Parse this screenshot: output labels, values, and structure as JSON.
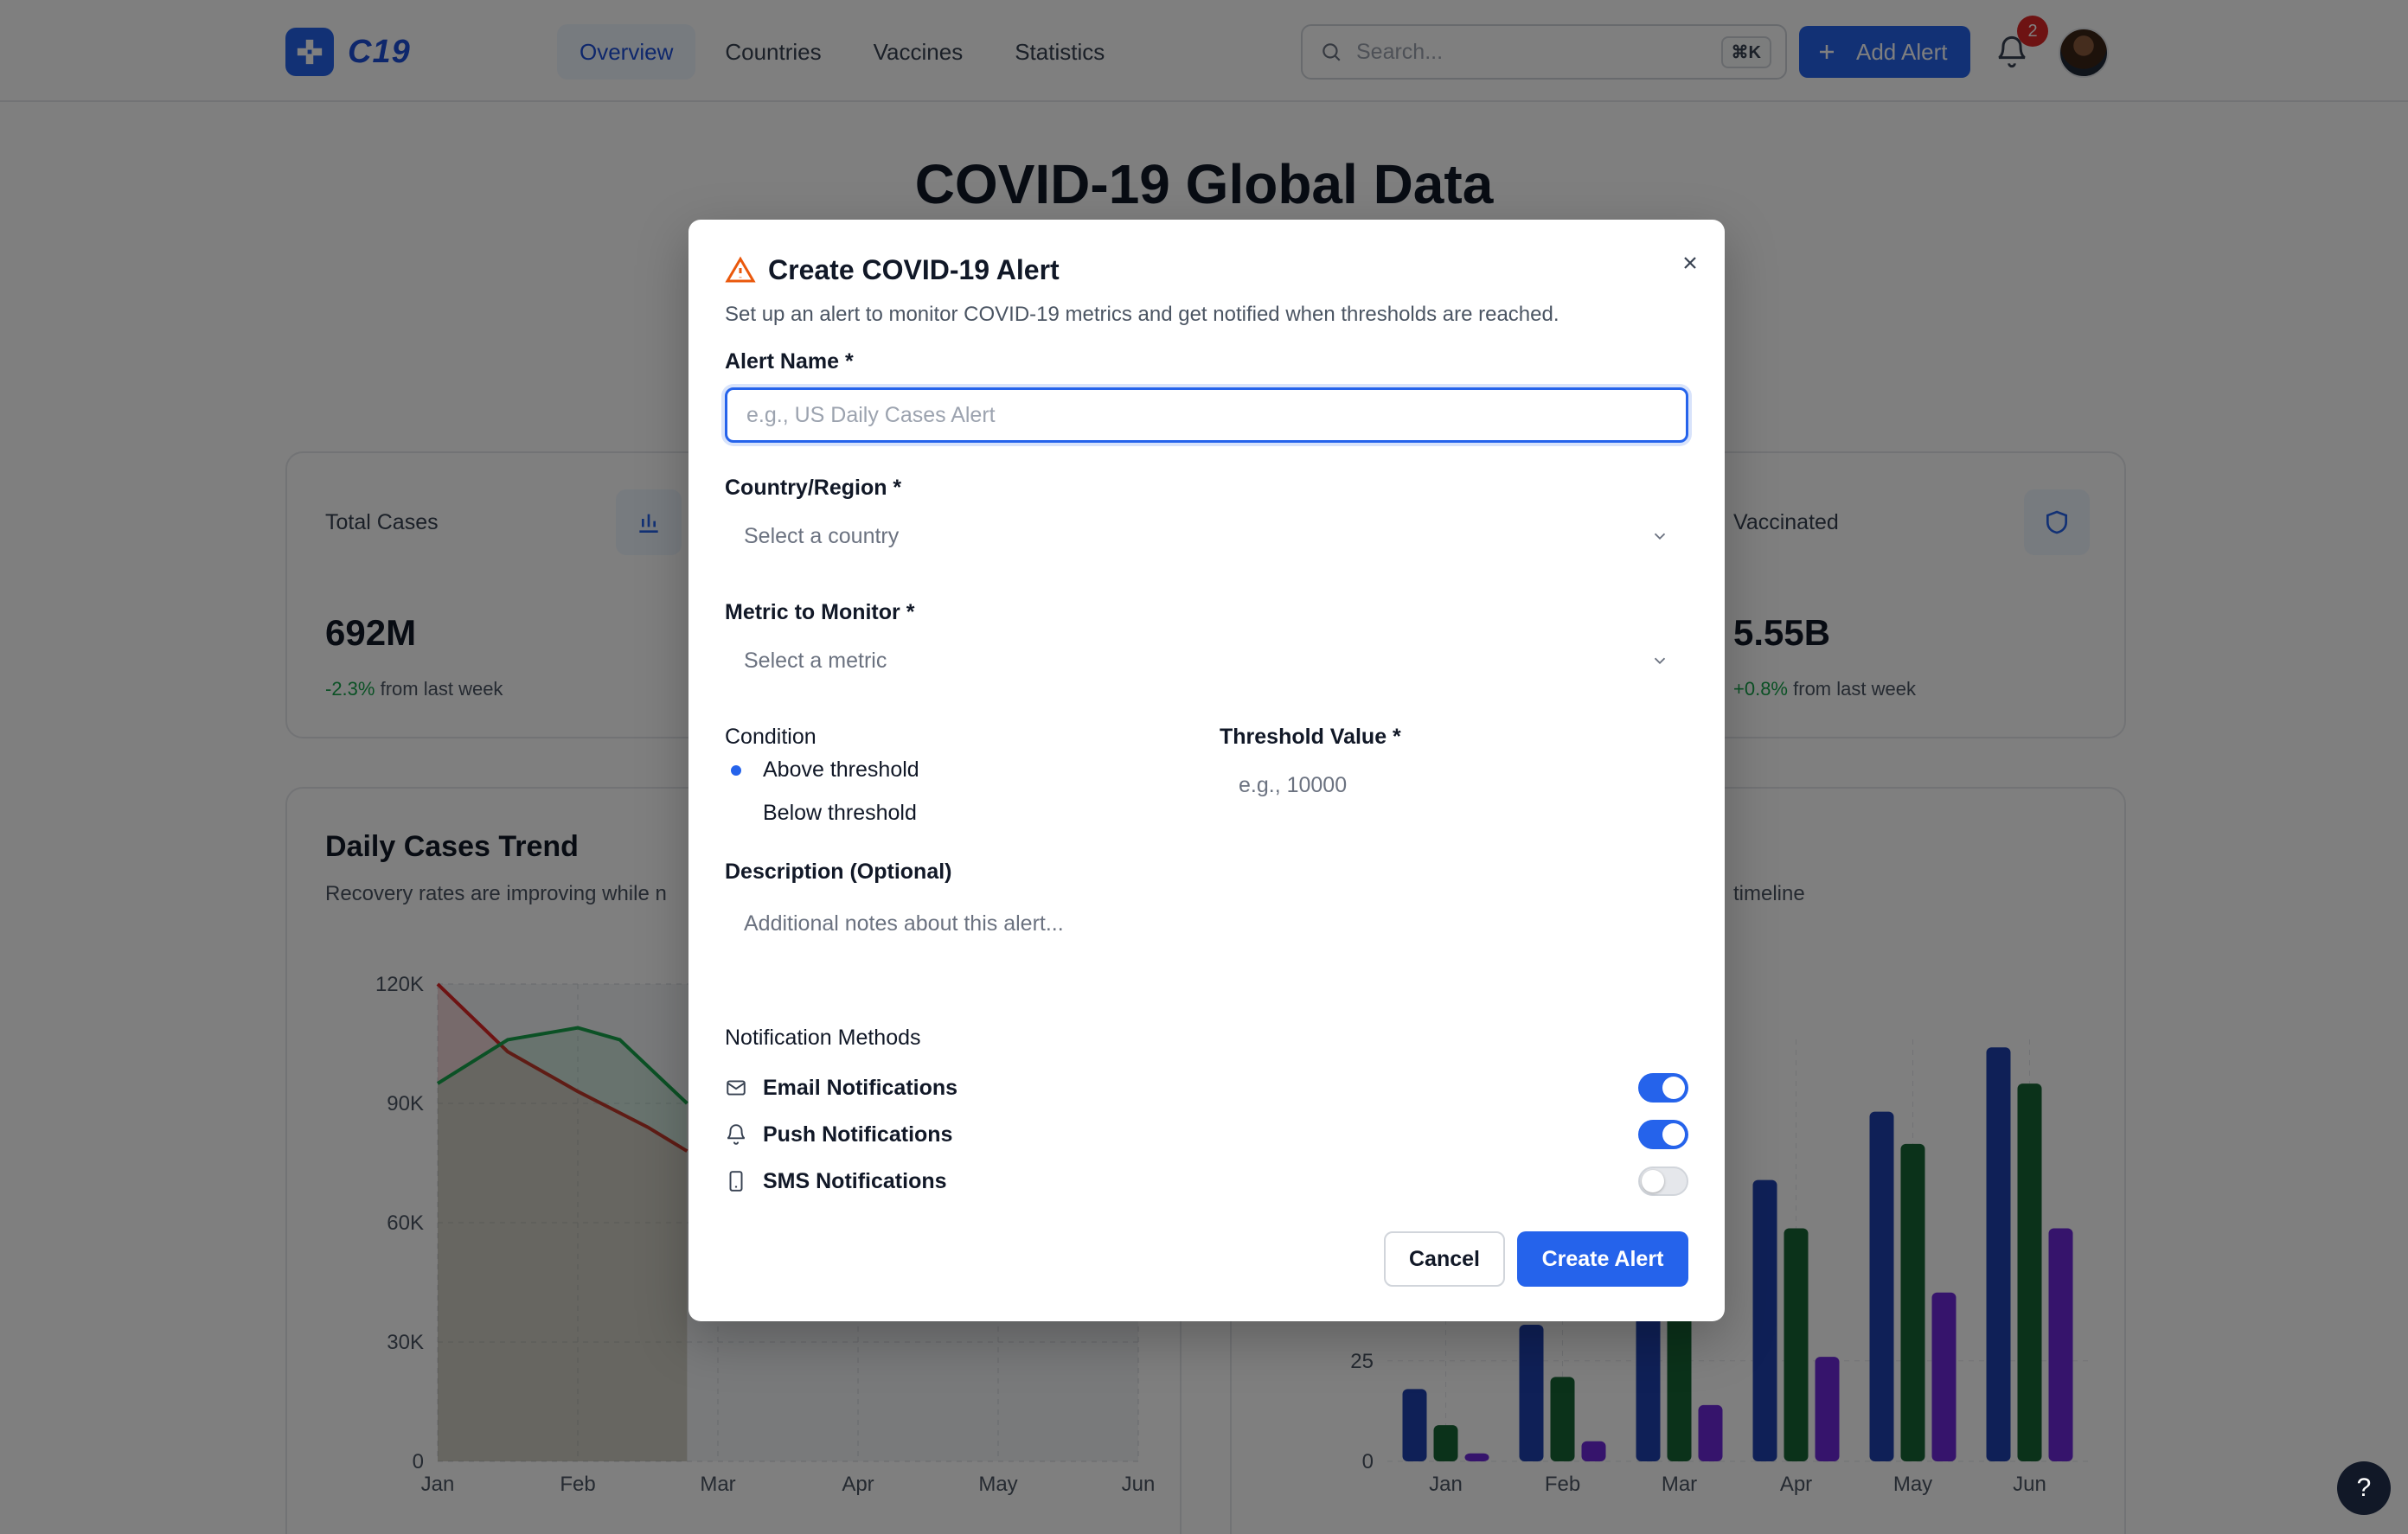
{
  "brand": {
    "name": "C19",
    "logo_icon": "plus-cross-icon",
    "color": "#2563eb"
  },
  "nav": {
    "tabs": [
      {
        "label": "Overview",
        "active": true
      },
      {
        "label": "Countries",
        "active": false
      },
      {
        "label": "Vaccines",
        "active": false
      },
      {
        "label": "Statistics",
        "active": false
      }
    ]
  },
  "search": {
    "placeholder": "Search...",
    "shortcut": "⌘K"
  },
  "header": {
    "add_alert_label": "Add Alert",
    "notification_count": "2"
  },
  "page": {
    "title": "COVID-19 Global Data"
  },
  "stats": [
    {
      "label": "Total Cases",
      "value": "692M",
      "change": "-2.3%",
      "change_suffix": "from last week",
      "icon": "bar-chart-icon"
    },
    {
      "label": "Vaccinated",
      "value": "5.55B",
      "change": "+0.8%",
      "change_suffix": "from last week",
      "icon": "shield-icon"
    }
  ],
  "charts": {
    "left": {
      "title": "Daily Cases Trend",
      "subtitle": "Recovery rates are improving while n"
    },
    "right": {
      "subtitle": "timeline"
    }
  },
  "chart_data": [
    {
      "type": "area",
      "title": "Daily Cases Trend",
      "categories": [
        "Jan",
        "Feb",
        "Mar",
        "Apr",
        "May",
        "Jun"
      ],
      "y_ticks": [
        "0",
        "30K",
        "60K",
        "90K",
        "120K"
      ],
      "ylim": [
        0,
        120000
      ],
      "series": [
        {
          "color": "#dc2626",
          "points": [
            [
              0,
              120000
            ],
            [
              0.5,
              103000
            ],
            [
              1,
              93000
            ],
            [
              1.5,
              84000
            ],
            [
              1.78,
              78000
            ]
          ]
        },
        {
          "color": "#16a34a",
          "points": [
            [
              0,
              95000
            ],
            [
              0.5,
              106000
            ],
            [
              1,
              109000
            ],
            [
              1.3,
              106000
            ],
            [
              1.6,
              96000
            ],
            [
              1.78,
              90000
            ]
          ]
        }
      ],
      "grid": true
    },
    {
      "type": "bar",
      "categories": [
        "Jan",
        "Feb",
        "Mar",
        "Apr",
        "May",
        "Jun"
      ],
      "y_ticks": [
        "0",
        "25"
      ],
      "ylim": [
        0,
        105
      ],
      "series": [
        {
          "color": "#1e40af",
          "values": [
            18,
            34,
            44,
            70,
            87,
            103
          ]
        },
        {
          "color": "#166534",
          "values": [
            9,
            21,
            46,
            58,
            79,
            94
          ]
        },
        {
          "color": "#6d28d9",
          "values": [
            2,
            5,
            14,
            26,
            42,
            58
          ]
        }
      ],
      "grid": true
    }
  ],
  "modal": {
    "title": "Create COVID-19 Alert",
    "title_icon": "warning-triangle-icon",
    "description": "Set up an alert to monitor COVID-19 metrics and get notified when thresholds are reached.",
    "alert_name": {
      "label": "Alert Name *",
      "placeholder": "e.g., US Daily Cases Alert",
      "value": ""
    },
    "country": {
      "label": "Country/Region *",
      "placeholder": "Select a country"
    },
    "metric": {
      "label": "Metric to Monitor *",
      "placeholder": "Select a metric"
    },
    "condition": {
      "label": "Condition",
      "options": [
        "Above threshold",
        "Below threshold"
      ],
      "selected": "Above threshold"
    },
    "threshold": {
      "label": "Threshold Value *",
      "placeholder": "e.g., 10000"
    },
    "notes": {
      "label": "Description (Optional)",
      "placeholder": "Additional notes about this alert..."
    },
    "notifications": {
      "label": "Notification Methods",
      "items": [
        {
          "label": "Email Notifications",
          "icon": "mail-icon",
          "enabled": true
        },
        {
          "label": "Push Notifications",
          "icon": "bell-icon",
          "enabled": true
        },
        {
          "label": "SMS Notifications",
          "icon": "phone-icon",
          "enabled": false
        }
      ]
    },
    "cancel_label": "Cancel",
    "create_label": "Create Alert"
  },
  "help": {
    "label": "?"
  }
}
